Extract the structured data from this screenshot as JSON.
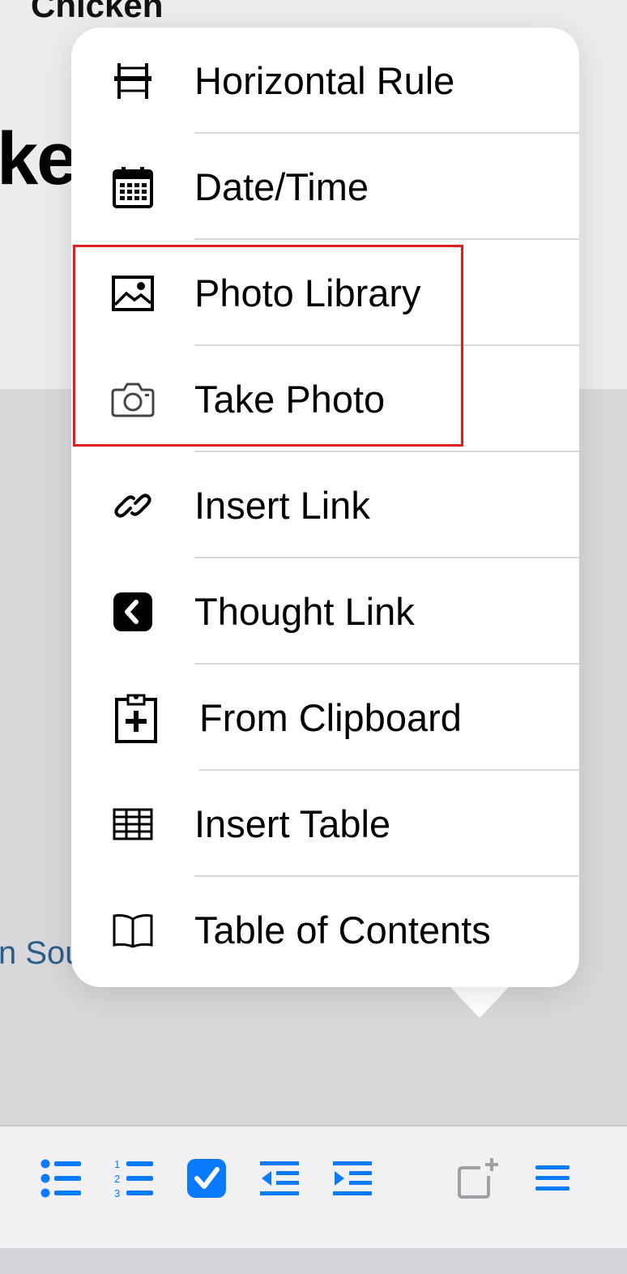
{
  "background": {
    "title_fragment": "Chicken",
    "heading_fragment": "ke",
    "link_fragment": "n Sou"
  },
  "menu": {
    "items": [
      {
        "label": "Horizontal Rule",
        "icon": "horizontal-rule-icon"
      },
      {
        "label": "Date/Time",
        "icon": "calendar-icon"
      },
      {
        "label": "Photo Library",
        "icon": "photo-icon"
      },
      {
        "label": "Take Photo",
        "icon": "camera-icon"
      },
      {
        "label": "Insert Link",
        "icon": "link-icon"
      },
      {
        "label": "Thought Link",
        "icon": "thought-link-icon"
      },
      {
        "label": "From Clipboard",
        "icon": "clipboard-plus-icon"
      },
      {
        "label": "Insert Table",
        "icon": "table-icon"
      },
      {
        "label": "Table of Contents",
        "icon": "book-icon"
      }
    ]
  },
  "toolbar": {
    "buttons": [
      {
        "icon": "bullet-list-icon"
      },
      {
        "icon": "numbered-list-icon"
      },
      {
        "icon": "checkbox-icon"
      },
      {
        "icon": "outdent-icon"
      },
      {
        "icon": "indent-icon"
      },
      {
        "icon": "add-block-icon"
      },
      {
        "icon": "menu-icon"
      }
    ],
    "accent_color": "#0a7aff",
    "inactive_color": "#a0a0a4"
  },
  "colors": {
    "highlight": "#e01e1e",
    "link": "#2a5d8a"
  }
}
